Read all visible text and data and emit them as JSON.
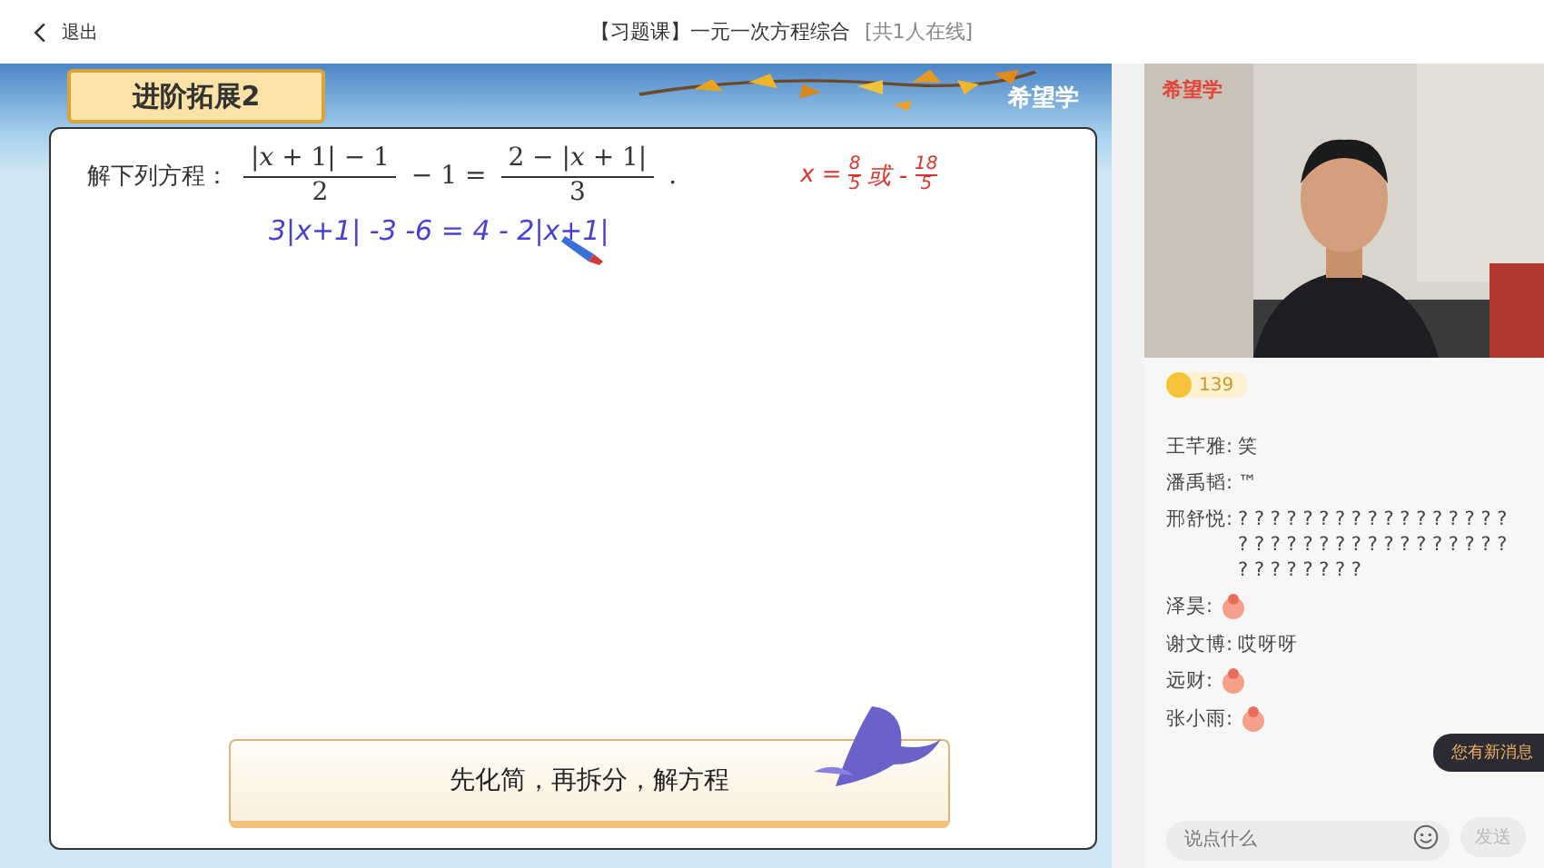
{
  "top_bar": {
    "back_label": "退出",
    "title": "【习题课】一元一次方程综合",
    "online": "[共1人在线]"
  },
  "slide": {
    "logo": "希望学",
    "section_title": "进阶拓展2",
    "problem": {
      "label": "解下列方程：",
      "lhs_num": "|*x* + 1| − 1",
      "lhs_den": "2",
      "middle": "− 1 =",
      "rhs_num": "2 − |*x* + 1|",
      "rhs_den": "3",
      "end": "."
    },
    "working": "3|x+1| -3 -6 = 4 - 2|x+1|",
    "answer": {
      "prefix": "x =",
      "num1": "8",
      "den1": "5",
      "mid": "或 -",
      "num2": "18",
      "den2": "5"
    },
    "tip": "先化简，再拆分，解方程"
  },
  "video": {
    "kind": "picture",
    "logo": "希望学"
  },
  "chat": {
    "coins": "139",
    "messages": [
      {
        "kind": "text",
        "name": "王芊雅:",
        "text": "笑"
      },
      {
        "kind": "text",
        "name": "潘禹韬:",
        "text": "™"
      },
      {
        "kind": "text",
        "name": "邢舒悦:",
        "text": "? ? ? ? ? ? ? ? ? ? ? ? ? ? ? ? ? ? ? ? ? ? ? ? ? ? ? ? ? ? ? ? ? ? ? ? ? ? ? ? ? ?"
      },
      {
        "kind": "sticker",
        "name": "泽昊:"
      },
      {
        "kind": "text",
        "name": "谢文博:",
        "text": "哎呀呀"
      },
      {
        "kind": "sticker",
        "name": "远财:"
      },
      {
        "kind": "sticker",
        "name": "张小雨:"
      }
    ],
    "new_message_badge": "您有新消息",
    "input": {
      "placeholder": "说点什么"
    },
    "send_button": {
      "label": "发送",
      "disabled": true
    }
  }
}
